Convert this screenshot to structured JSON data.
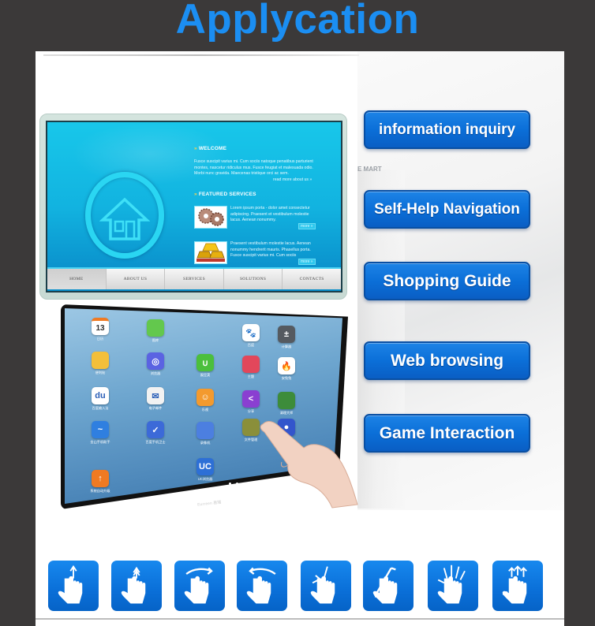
{
  "title": "Applycation",
  "colors": {
    "title_blue": "#1b8ef2",
    "button_blue": "#0b6fd8",
    "background_dark": "#3b3939"
  },
  "kiosk_website": {
    "welcome_heading": "WELCOME",
    "welcome_body": "Fusce suscipit varius mi. Cum sociis natoque penatibus parturient montes, nascetur ridiculus mus. Fusce feugiat et malesuada odio. Morbi nunc gravida. Maecenas tristique orci ac sem.",
    "read_more": "read more about us »",
    "featured_heading": "FEATURED SERVICES",
    "services": [
      {
        "thumb": "gears-image",
        "text": "Lorem ipsum porta - dolor amet consectetur adipiscing. Praesent et vestibulum molestie lacus. Aenean nonummy.",
        "more": "more »"
      },
      {
        "thumb": "gold-bars-image",
        "text": "Praesent vestibulum molestie lacus. Aenean nonummy hendrerit mauris. Phasellus porta. Fusce suscipit varius mi. Cum sociis",
        "more": "more »"
      }
    ],
    "nav": [
      "HOME",
      "ABOUT US",
      "SERVICES",
      "SOLUTIONS",
      "CONTACTS"
    ],
    "active_nav": "HOME"
  },
  "background_sign": "E MART",
  "tablet": {
    "apps": [
      {
        "name": "calendar",
        "icon_text": "13",
        "label": "日历",
        "color": "#ffffff"
      },
      {
        "name": "photos",
        "icon_text": "",
        "label": "图库",
        "color": "#63c84d"
      },
      {
        "name": "baidu",
        "icon_text": "🐾",
        "label": "百度",
        "color": "#ffffff"
      },
      {
        "name": "calculator",
        "icon_text": "±",
        "label": "计算器",
        "color": "#555a60"
      },
      {
        "name": "notes",
        "icon_text": "",
        "label": "便利贴",
        "color": "#f3bf3a"
      },
      {
        "name": "browser",
        "icon_text": "◎",
        "label": "浏览器",
        "color": "#5b63e2"
      },
      {
        "name": "wandoujia",
        "icon_text": "∪",
        "label": "豌豆荚",
        "color": "#4bbf3c"
      },
      {
        "name": "themes",
        "icon_text": "",
        "label": "主题",
        "color": "#e2475b"
      },
      {
        "name": "antutu",
        "icon_text": "🔥",
        "label": "安兔兔",
        "color": "#ffffff"
      },
      {
        "name": "input-method",
        "icon_text": "du",
        "label": "百度输入法",
        "color": "#ffffff"
      },
      {
        "name": "email",
        "icon_text": "✉",
        "label": "电子邮件",
        "color": "#f2f2f2"
      },
      {
        "name": "smile",
        "icon_text": "☺",
        "label": "乐视",
        "color": "#f39a2e"
      },
      {
        "name": "share",
        "icon_text": "<",
        "label": "分享",
        "color": "#8a3fd1"
      },
      {
        "name": "cleaner",
        "icon_text": "",
        "label": "清理大师",
        "color": "#3d8c3a"
      },
      {
        "name": "kingsoft",
        "icon_text": "~",
        "label": "金山手机助手",
        "color": "#2f7fe0"
      },
      {
        "name": "security",
        "icon_text": "✓",
        "label": "百度手机卫士",
        "color": "#3c6ad8"
      },
      {
        "name": "recorder",
        "icon_text": "",
        "label": "录像机",
        "color": "#4c7fe0"
      },
      {
        "name": "files",
        "icon_text": "",
        "label": "文件管理",
        "color": "#8a8f3a"
      },
      {
        "name": "camera",
        "icon_text": "●",
        "label": "相机",
        "color": "#3355cc"
      },
      {
        "name": "uc-browser",
        "icon_text": "UC",
        "label": "UC浏览器",
        "color": "#2d6fd6"
      },
      {
        "name": "updater",
        "icon_text": "↑",
        "label": "系统自动升级",
        "color": "#f07a22"
      }
    ],
    "brand": "Eurreen 易瑞"
  },
  "features": [
    "information inquiry",
    "Self-Help Navigation",
    "Shopping Guide",
    "Web browsing",
    "Game Interaction"
  ],
  "gestures": [
    "tap-icon",
    "double-tap-icon",
    "swipe-right-icon",
    "swipe-left-icon",
    "pinch-icon",
    "spread-icon",
    "five-finger-spread-icon",
    "multi-finger-swipe-icon"
  ]
}
